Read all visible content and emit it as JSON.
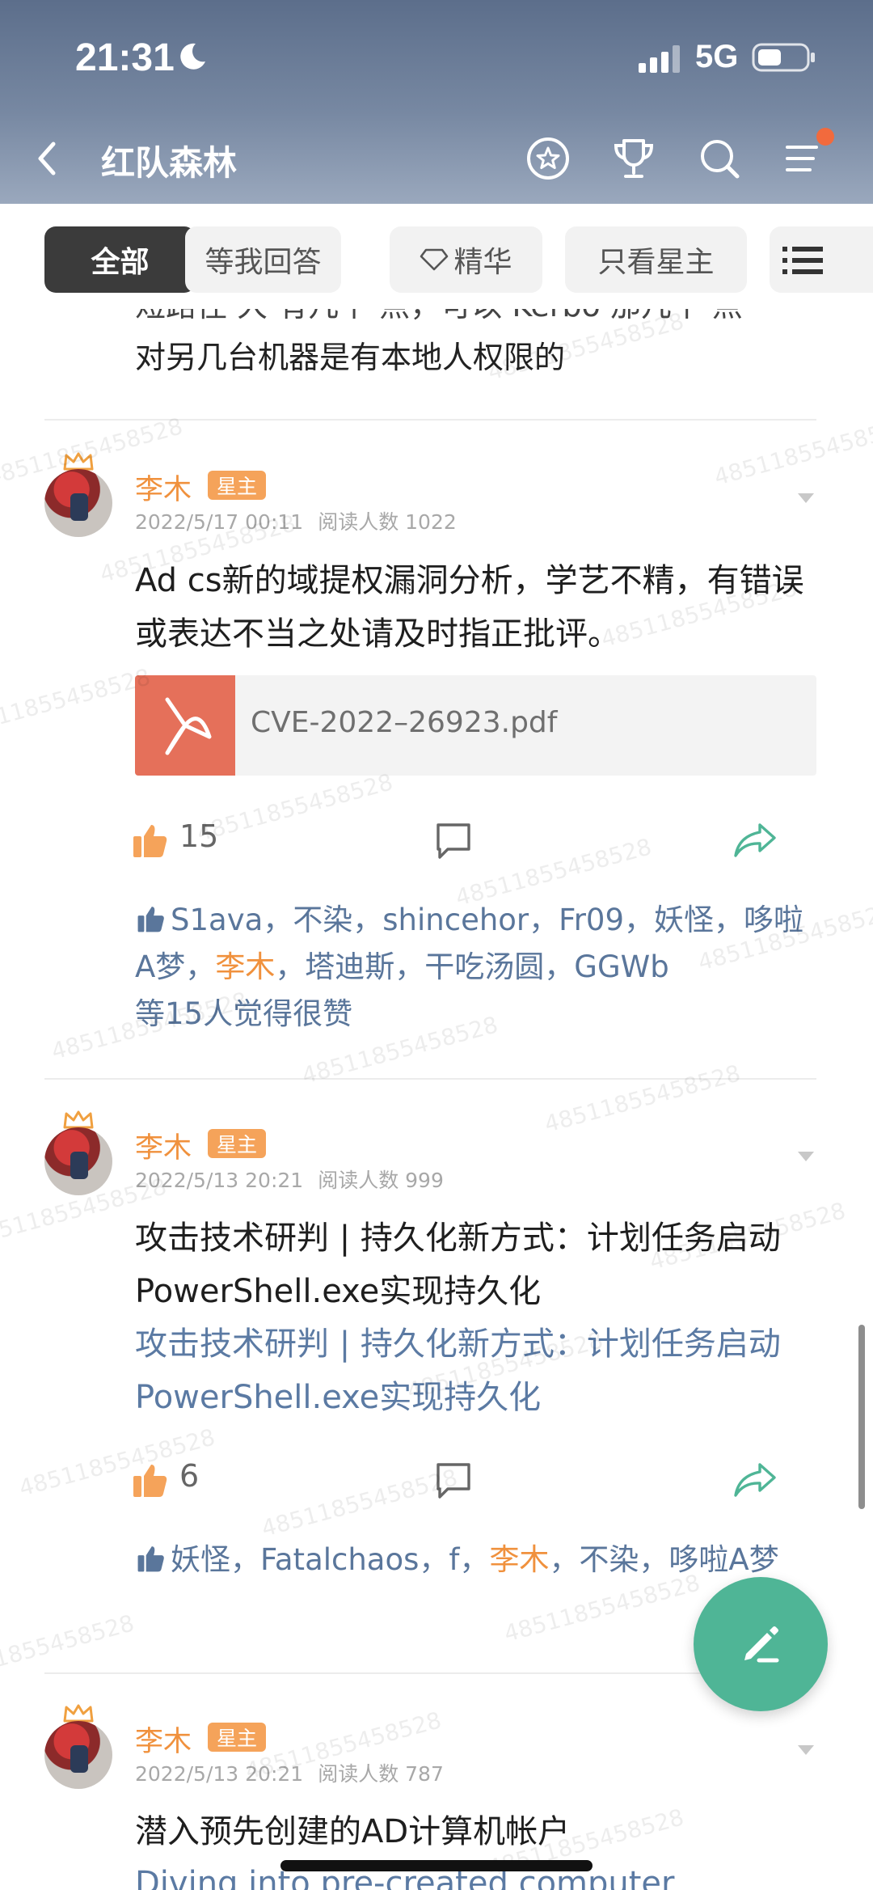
{
  "status": {
    "time": "21:31",
    "network": "5G"
  },
  "nav": {
    "title": "红队森林"
  },
  "tabs": [
    {
      "label": "全部",
      "active": true
    },
    {
      "label": "等我回答"
    },
    {
      "label": "精华"
    },
    {
      "label": "只看星主"
    }
  ],
  "watermark": "48511855458528",
  "colors": {
    "accent": "#4fb596",
    "author": "#f0913d",
    "link": "#5b7aa3",
    "pdf": "#e5705a"
  },
  "partial_post": {
    "line1": "短路径 大 有几个 点，可以 Kerbo 那几个 点",
    "line2": "对另几台机器是有本地人权限的"
  },
  "posts": [
    {
      "author": "李木",
      "badge": "星主",
      "date": "2022/5/17 00:11",
      "reads": "阅读人数 1022",
      "body": "Ad cs新的域提权漏洞分析，学艺不精，有错误或表达不当之处请及时指正批评。",
      "attachment": "CVE-2022–26923.pdf",
      "likes": "15",
      "likers": "S1ava，不染，shincehor，Fr09，妖怪，哆啦A梦，",
      "likers_me": "李木",
      "likers_rest": "，塔迪斯，干吃汤圆，GGWb",
      "likers_suffix": "等15人觉得很赞"
    },
    {
      "author": "李木",
      "badge": "星主",
      "date": "2022/5/13 20:21",
      "reads": "阅读人数 999",
      "body": "攻击技术研判 | 持久化新方式：计划任务启动PowerShell.exe实现持久化",
      "link": "攻击技术研判 | 持久化新方式：计划任务启动PowerShell.exe实现持久化",
      "likes": "6",
      "likers": "妖怪，Fatalchaos，f，",
      "likers_me": "李木",
      "likers_rest": "，不染，哆啦A梦"
    },
    {
      "author": "李木",
      "badge": "星主",
      "date": "2022/5/13 20:21",
      "reads": "阅读人数 787",
      "body": "潜入预先创建的AD计算机帐户",
      "link": "Diving into pre-created computer"
    }
  ]
}
